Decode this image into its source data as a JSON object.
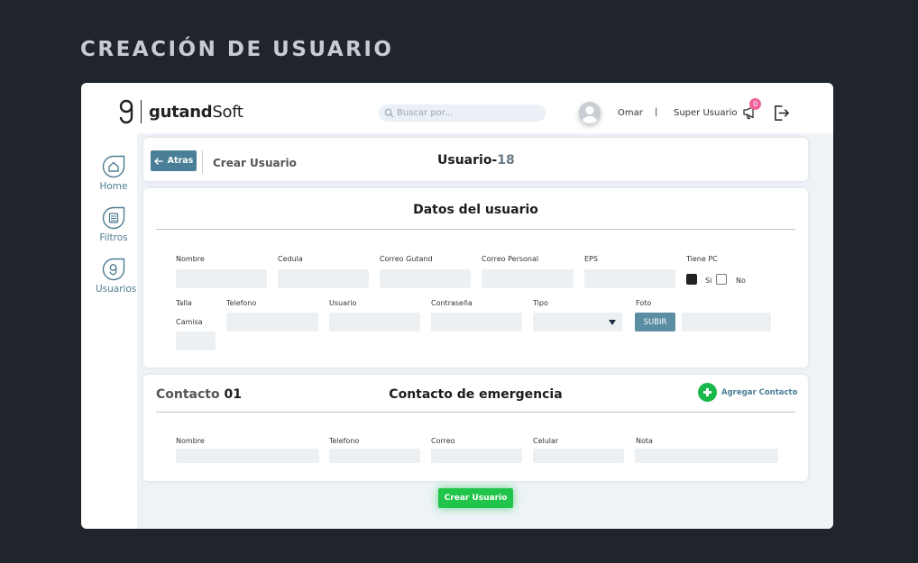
{
  "page_heading": "CREACIÓN DE USUARIO",
  "header": {
    "logo_bold": "gutand",
    "logo_light": "Soft",
    "search_placeholder": "Buscar por...",
    "user_name": "Omar",
    "separator": "|",
    "role": "Super Usuario",
    "notifications_count": "0"
  },
  "sidebar": {
    "items": [
      {
        "label": "Home",
        "icon": "home-icon"
      },
      {
        "label": "Filtros",
        "icon": "filter-icon"
      },
      {
        "label": "Usuarios",
        "icon": "users-icon"
      }
    ]
  },
  "top_bar": {
    "back_label": "Atras",
    "breadcrumb": "Crear Usuario",
    "title_prefix": "Usuario-",
    "title_number": "18"
  },
  "user_form": {
    "title": "Datos del usuario",
    "labels": {
      "nombre": "Nombre",
      "cedula": "Cedula",
      "correo_gutand": "Correo Gutand",
      "correo_personal": "Correo Personal",
      "eps": "EPS",
      "tiene_pc": "Tiene PC",
      "si": "Si",
      "no": "No",
      "talla": "Talla",
      "camisa": "Camisa",
      "telefono": "Telefono",
      "usuario": "Usuario",
      "contrasena": "Contraseña",
      "tipo": "Tipo",
      "foto": "Foto"
    },
    "upload_label": "SUBIR",
    "tiene_pc_value": "Si"
  },
  "contact_form": {
    "contact_label": "Contacto",
    "contact_number": "01",
    "title": "Contacto de emergencia",
    "add_label": "Agregar Contacto",
    "labels": {
      "nombre": "Nombre",
      "telefono": "Telefono",
      "correo": "Correo",
      "celular": "Celular",
      "nota": "Nota"
    }
  },
  "create_button": "Crear Usuario",
  "colors": {
    "background": "#1f252b",
    "accent": "#4a7f97",
    "primary_green": "#21c44b",
    "badge": "#f0609a"
  }
}
